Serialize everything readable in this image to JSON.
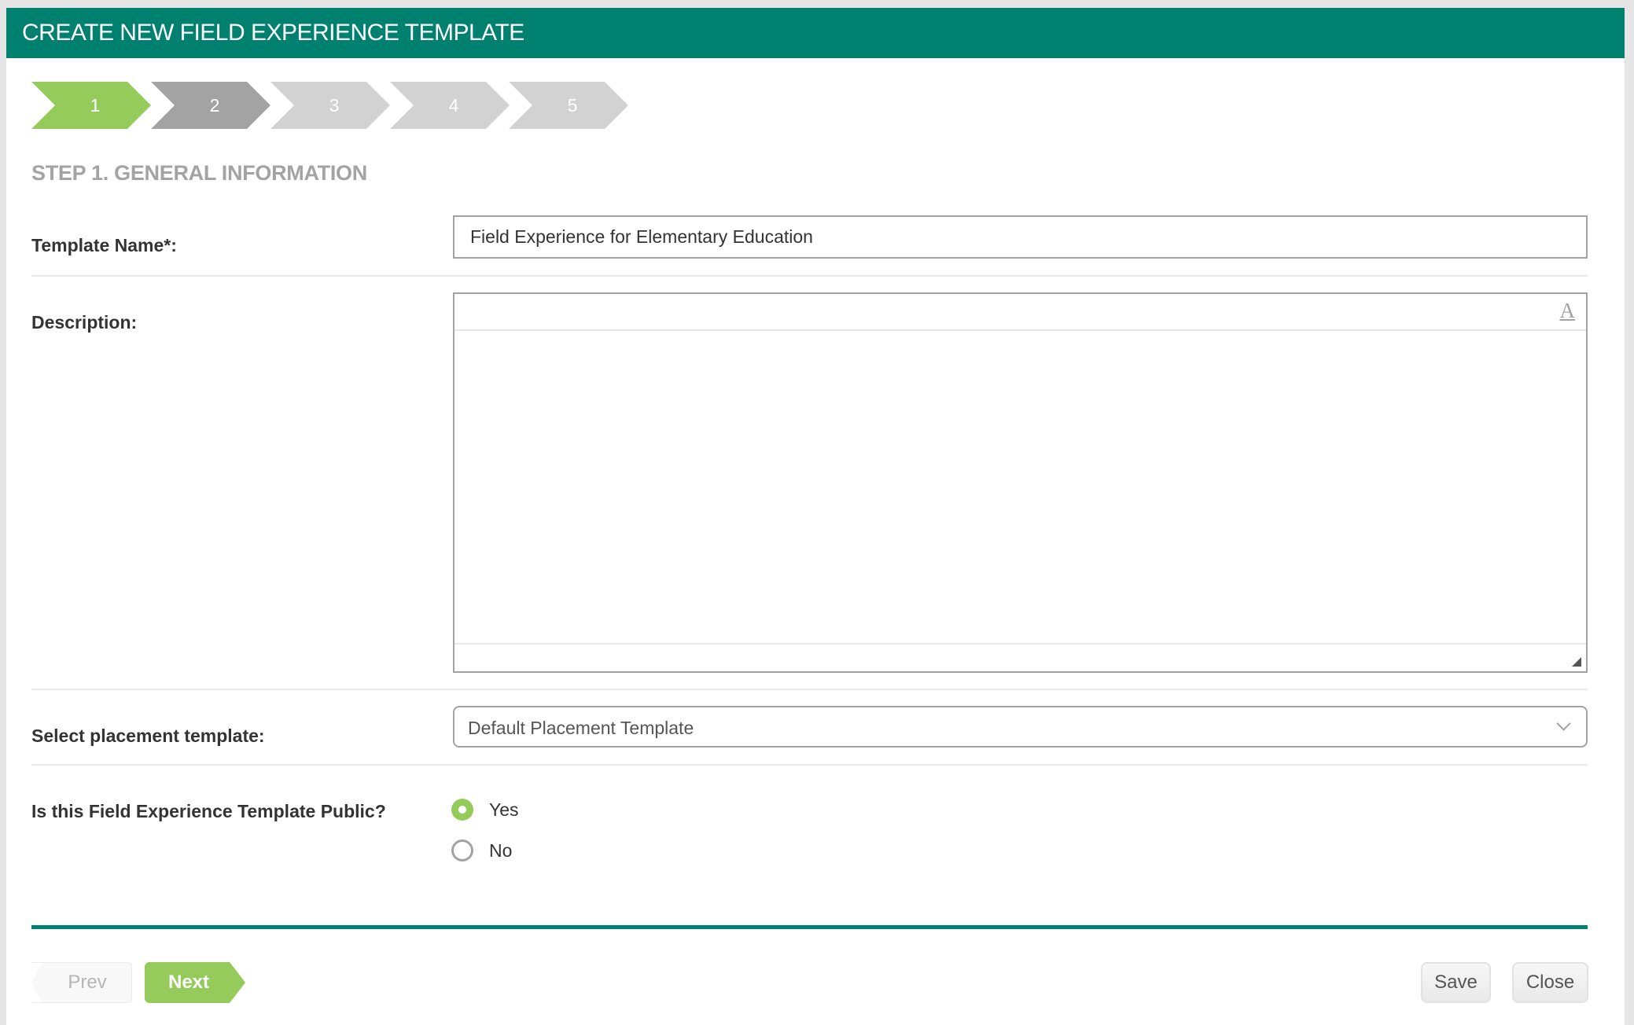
{
  "header": {
    "title": "CREATE NEW FIELD EXPERIENCE TEMPLATE"
  },
  "colors": {
    "brand_teal": "#00806f",
    "step_active": "#95cb5b",
    "step_next": "#a3a3a3",
    "step_future": "#d2d2d2"
  },
  "wizard": {
    "steps": [
      {
        "label": "1",
        "state": "active"
      },
      {
        "label": "2",
        "state": "next"
      },
      {
        "label": "3",
        "state": "future"
      },
      {
        "label": "4",
        "state": "future"
      },
      {
        "label": "5",
        "state": "future"
      }
    ],
    "current_step": 1,
    "total_steps": 5
  },
  "form": {
    "heading": "STEP 1. GENERAL INFORMATION",
    "template_name": {
      "label": "Template Name*:",
      "value": "Field Experience for Elementary Education"
    },
    "description": {
      "label": "Description:",
      "value": "",
      "toolbar_icon": "font-format-icon"
    },
    "placement_template": {
      "label": "Select placement template:",
      "selected": "Default Placement Template"
    },
    "public": {
      "label": "Is this Field Experience Template Public?",
      "options": [
        {
          "label": "Yes",
          "checked": true
        },
        {
          "label": "No",
          "checked": false
        }
      ]
    }
  },
  "footer": {
    "prev_label": "Prev",
    "next_label": "Next",
    "save_label": "Save",
    "close_label": "Close"
  }
}
